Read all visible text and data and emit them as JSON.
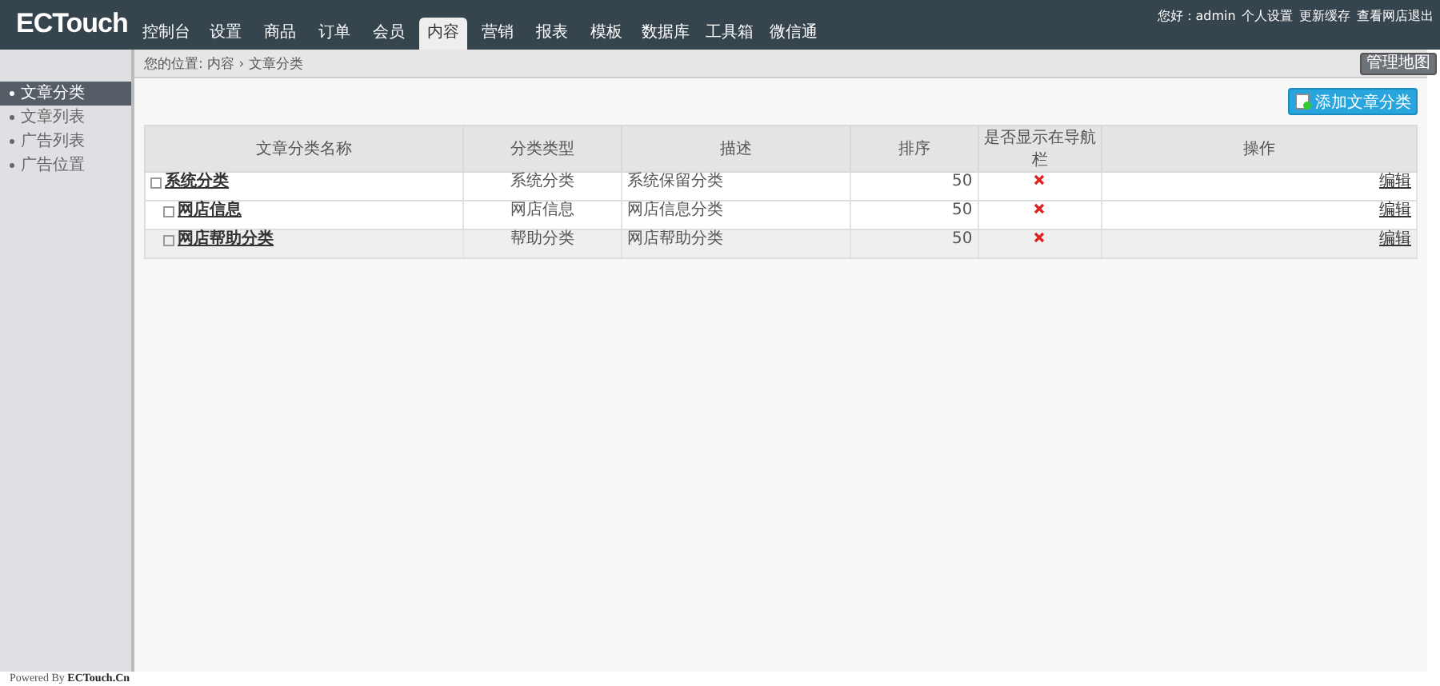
{
  "logo": "ECTouch",
  "nav": [
    {
      "label": "控制台",
      "selected": false
    },
    {
      "label": "设置",
      "selected": false
    },
    {
      "label": "商品",
      "selected": false
    },
    {
      "label": "订单",
      "selected": false
    },
    {
      "label": "会员",
      "selected": false
    },
    {
      "label": "内容",
      "selected": true
    },
    {
      "label": "营销",
      "selected": false
    },
    {
      "label": "报表",
      "selected": false
    },
    {
      "label": "模板",
      "selected": false
    },
    {
      "label": "数据库",
      "selected": false
    },
    {
      "label": "工具箱",
      "selected": false
    },
    {
      "label": "微信通",
      "selected": false
    }
  ],
  "user_links": [
    "您好：admin",
    "个人设置",
    "更新缓存",
    "查看网店",
    "退出"
  ],
  "breadcrumb": "您的位置: 内容 › 文章分类",
  "sitemap_button": "管理地图",
  "sidebar": [
    {
      "label": "文章分类",
      "selected": true
    },
    {
      "label": "文章列表",
      "selected": false
    },
    {
      "label": "广告列表",
      "selected": false
    },
    {
      "label": "广告位置",
      "selected": false
    }
  ],
  "add_button": "添加文章分类",
  "table": {
    "columns": [
      "文章分类名称",
      "分类类型",
      "描述",
      "排序",
      "是否显示在导航栏",
      "操作"
    ],
    "rows": [
      {
        "name": "系统分类",
        "type": "系统分类",
        "description": "系统保留分类",
        "order": "50",
        "show_in_nav": false,
        "action": "编辑",
        "highlighted": false,
        "children": [
          {
            "name": "网店信息",
            "type": "网店信息",
            "description": "网店信息分类",
            "order": "50",
            "show_in_nav": false,
            "action": "编辑",
            "highlighted": false
          },
          {
            "name": "网店帮助分类",
            "type": "帮助分类",
            "description": "网店帮助分类",
            "order": "50",
            "show_in_nav": false,
            "action": "编辑",
            "highlighted": true
          }
        ]
      }
    ]
  },
  "footer": {
    "prefix": "Powered By",
    "brand": "ECTouch.Cn"
  }
}
